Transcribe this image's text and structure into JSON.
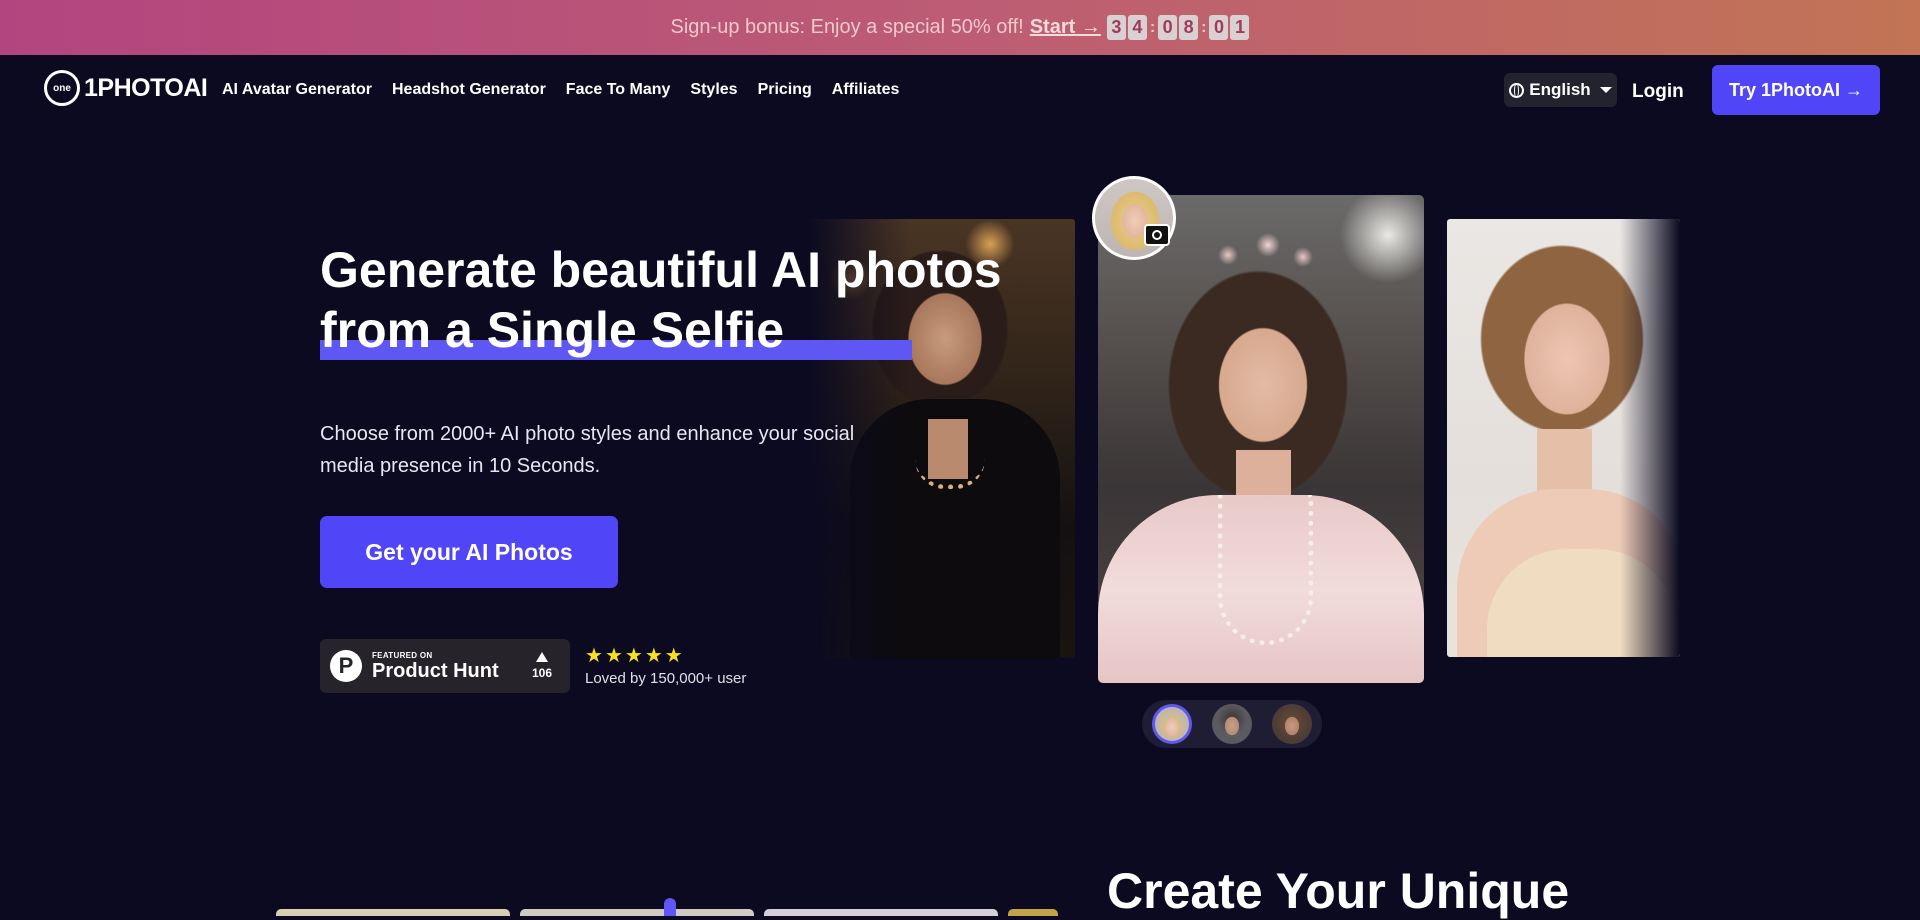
{
  "promo": {
    "text": "Sign-up bonus: Enjoy a special 50% off!",
    "cta": "Start →",
    "countdown": [
      "3",
      "4",
      "0",
      "8",
      "0",
      "1"
    ]
  },
  "nav": {
    "logo_mark": "one",
    "logo_text": "1PHOTOAI",
    "links": [
      "AI Avatar Generator",
      "Headshot Generator",
      "Face To Many",
      "Styles",
      "Pricing",
      "Affiliates"
    ],
    "language": "English",
    "login": "Login",
    "try_button": "Try 1PhotoAI →"
  },
  "hero": {
    "title_line1": "Generate beautiful AI photos",
    "title_line2": "from a Single Selfie",
    "subtitle": "Choose from 2000+ AI photo styles and enhance your social media presence in 10 Seconds.",
    "cta": "Get your AI Photos",
    "product_hunt": {
      "logo": "P",
      "featured": "FEATURED ON",
      "name": "Product Hunt",
      "votes": "106"
    },
    "rating_stars": 5,
    "loved": "Loved by 150,000+ user"
  },
  "section2": {
    "title": "Create Your Unique"
  },
  "colors": {
    "background": "#0b0a20",
    "accent": "#5146f7",
    "star": "#f7e01d"
  }
}
